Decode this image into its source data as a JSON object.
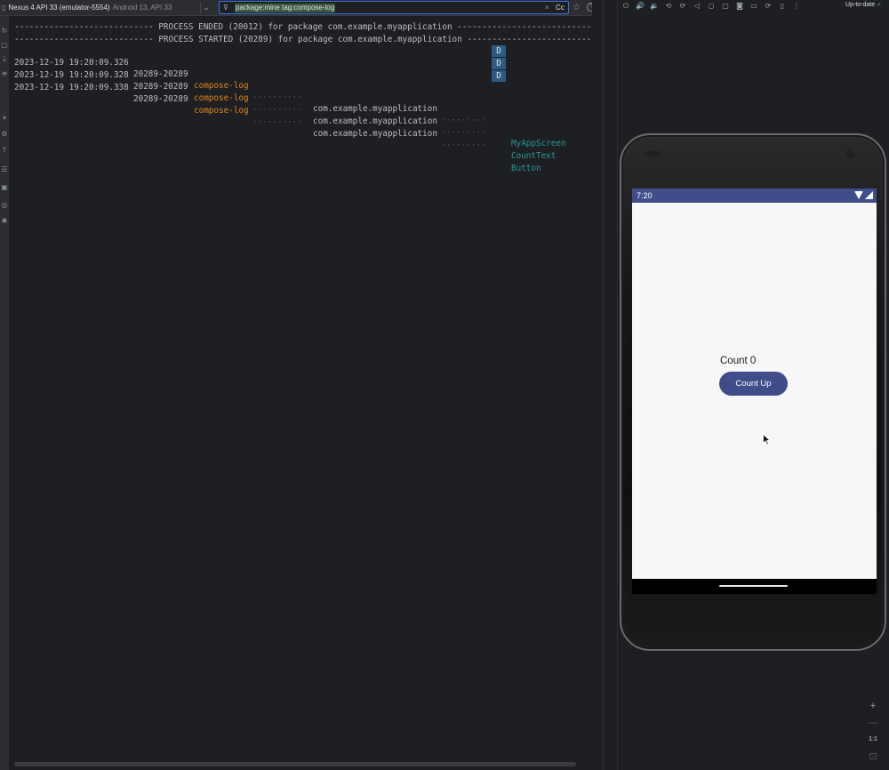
{
  "logcat": {
    "device_name": "Nexus 4 API 33 (emulator-5554)",
    "device_info": "Android 13, API 33",
    "filter_query": "package:mine tag:compose-log",
    "case_toggle": "Cc",
    "separators": [
      "---------------------------- PROCESS ENDED (20012) for package com.example.myapplication ----------------------------",
      "---------------------------- PROCESS STARTED (20289) for package com.example.myapplication ----------------------------"
    ],
    "rows": [
      {
        "timestamp": "2023-12-19 19:20:09.326",
        "pid": "20289-20289",
        "tag": "compose-log",
        "dots1": "··········",
        "package": "com.example.myapplication",
        "dots2": "·········",
        "level": "D",
        "message": "MyAppScreen"
      },
      {
        "timestamp": "2023-12-19 19:20:09.328",
        "pid": "20289-20289",
        "tag": "compose-log",
        "dots1": "··········",
        "package": "com.example.myapplication",
        "dots2": "·········",
        "level": "D",
        "message": "CountText"
      },
      {
        "timestamp": "2023-12-19 19:20:09.338",
        "pid": "20289-20289",
        "tag": "compose-log",
        "dots1": "··········",
        "package": "com.example.myapplication",
        "dots2": "·········",
        "level": "D",
        "message": "Button"
      }
    ]
  },
  "emulator": {
    "status_text": "Up-to-date",
    "status_check": "✓",
    "android_time": "7:20",
    "count_text": "Count 0",
    "button_label": "Count Up",
    "zoom_in": "+",
    "zoom_out": "—",
    "zoom_actual": "1:1"
  },
  "colors": {
    "accent": "#3f4d8a",
    "tag_orange": "#e2841d",
    "message_teal": "#299999",
    "level_badge": "#2d5b83"
  }
}
